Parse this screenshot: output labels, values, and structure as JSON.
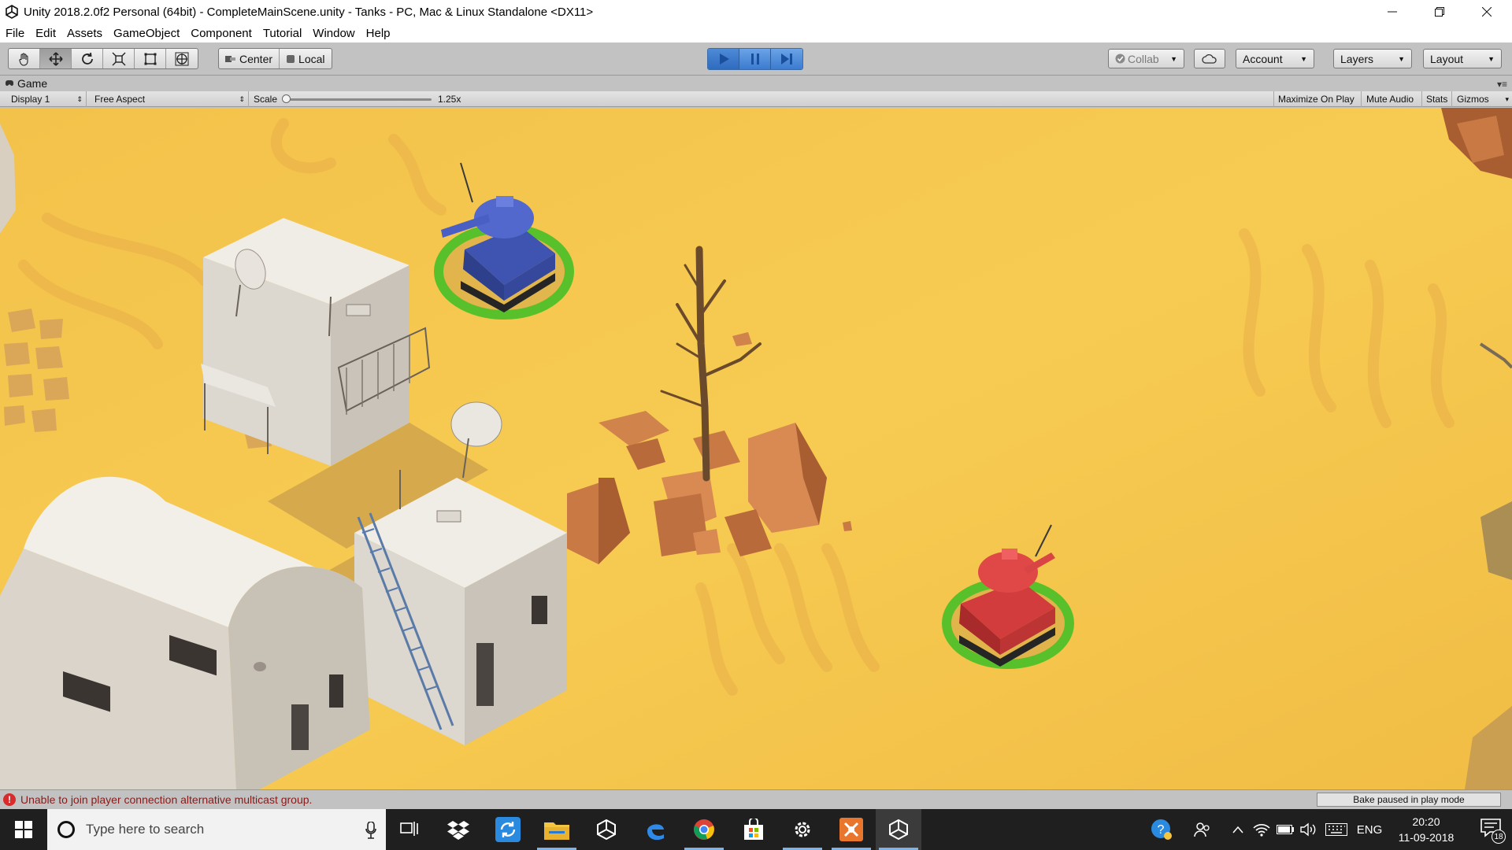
{
  "window": {
    "title": "Unity 2018.2.0f2 Personal (64bit) - CompleteMainScene.unity - Tanks - PC, Mac & Linux Standalone <DX11>",
    "controls": [
      "minimize",
      "restore",
      "close"
    ]
  },
  "menu": [
    "File",
    "Edit",
    "Assets",
    "GameObject",
    "Component",
    "Tutorial",
    "Window",
    "Help"
  ],
  "toolbar": {
    "tools": [
      "hand-icon",
      "move-icon",
      "rotate-icon",
      "scale-icon",
      "rect-icon",
      "transform-icon"
    ],
    "active_tool": "move-icon",
    "pivot_label": "Center",
    "space_label": "Local",
    "collab_label": "Collab",
    "account_label": "Account",
    "layers_label": "Layers",
    "layout_label": "Layout"
  },
  "game_view": {
    "tab_label": "Game",
    "display_label": "Display 1",
    "aspect_label": "Free Aspect",
    "scale_label": "Scale",
    "scale_value": "1.25x",
    "maximize_label": "Maximize On Play",
    "mute_label": "Mute Audio",
    "stats_label": "Stats",
    "gizmos_label": "Gizmos"
  },
  "status": {
    "message": "Unable to join player connection alternative multicast group.",
    "bake_label": "Bake paused in play mode"
  },
  "taskbar": {
    "search_placeholder": "Type here to search",
    "apps": [
      "task-view-icon",
      "dropbox-icon",
      "sync-icon",
      "file-explorer-icon",
      "unity-hub-icon",
      "edge-icon",
      "chrome-icon",
      "store-icon",
      "settings-icon",
      "blender-icon",
      "unity-icon"
    ],
    "language": "ENG",
    "time": "20:20",
    "date": "11-09-2018",
    "notification_count": "18"
  },
  "colors": {
    "sand": "#f5c64a",
    "tank_blue": "#4a5fc4",
    "tank_red": "#d94444",
    "ring_green": "#5fc22b",
    "play_blue": "#3b7bd0"
  }
}
